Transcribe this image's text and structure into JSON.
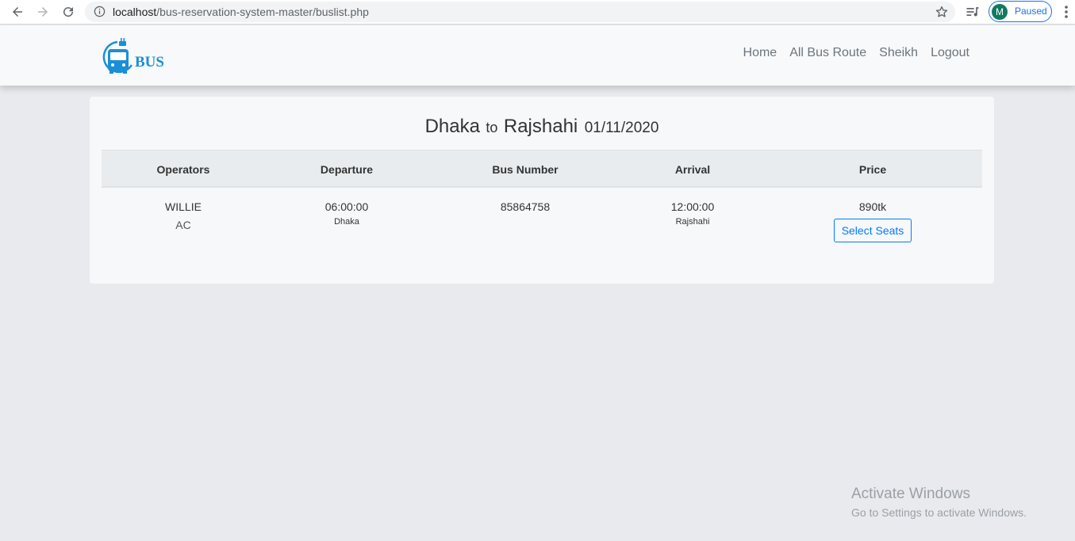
{
  "browser": {
    "url_host": "localhost",
    "url_path": "/bus-reservation-system-master/buslist.php",
    "profile_initial": "M",
    "profile_status": "Paused"
  },
  "navbar": {
    "logo_text": "BUS",
    "links": [
      "Home",
      "All Bus Route",
      "Sheikh",
      "Logout"
    ]
  },
  "route": {
    "from": "Dhaka",
    "connector": "to",
    "to": "Rajshahi",
    "date": "01/11/2020"
  },
  "table": {
    "headers": [
      "Operators",
      "Departure",
      "Bus Number",
      "Arrival",
      "Price"
    ],
    "rows": [
      {
        "operator": "WILLIE",
        "type": "AC",
        "departure_time": "06:00:00",
        "departure_city": "Dhaka",
        "bus_number": "85864758",
        "arrival_time": "12:00:00",
        "arrival_city": "Rajshahi",
        "price": "890tk",
        "action_label": "Select Seats"
      }
    ]
  },
  "watermark": {
    "line1": "Activate Windows",
    "line2": "Go to Settings to activate Windows."
  },
  "colors": {
    "accent": "#007bff",
    "logo": "#1a8fd6",
    "page_bg": "#e9eaed"
  }
}
